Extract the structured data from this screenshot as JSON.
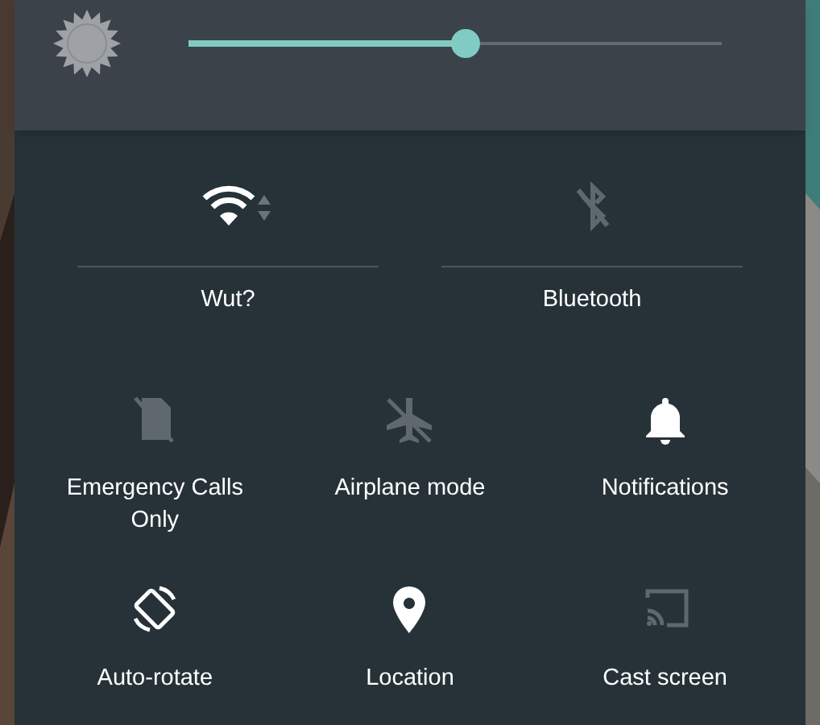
{
  "brightness": {
    "level": 0.52
  },
  "wide_tiles": [
    {
      "kind": "wifi",
      "label": "Wut?",
      "on": true,
      "activity": true
    },
    {
      "kind": "bluetooth",
      "label": "Bluetooth",
      "on": false
    }
  ],
  "tiles": [
    {
      "kind": "sim",
      "label": "Emergency Calls Only",
      "on": false
    },
    {
      "kind": "airplane",
      "label": "Airplane mode",
      "on": false
    },
    {
      "kind": "bell",
      "label": "Notifications",
      "on": true
    },
    {
      "kind": "rotate",
      "label": "Auto-rotate",
      "on": true
    },
    {
      "kind": "pin",
      "label": "Location",
      "on": true
    },
    {
      "kind": "cast",
      "label": "Cast screen",
      "on": false
    }
  ]
}
